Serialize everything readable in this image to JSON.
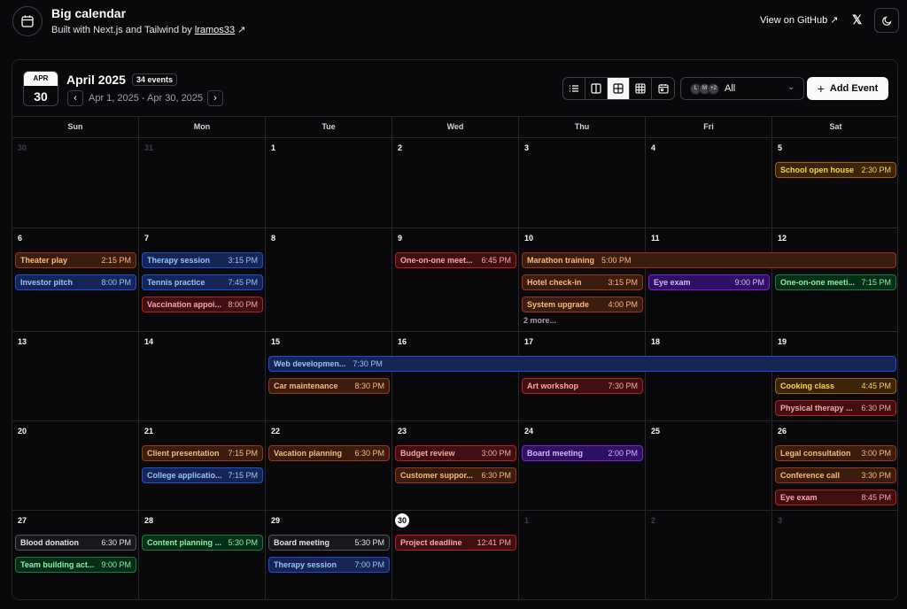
{
  "app": {
    "title": "Big calendar",
    "subtitle_prefix": "Built with Next.js and Tailwind by",
    "author": "lramos33",
    "github_label": "View on GitHub"
  },
  "toolbar": {
    "badge_month": "APR",
    "badge_day": "30",
    "month_title": "April 2025",
    "event_count": "34 events",
    "range": "Apr 1, 2025 - Apr 30, 2025",
    "user_filter": "All",
    "avatars": [
      "L",
      "M",
      "+2"
    ],
    "add_event": "Add Event"
  },
  "weekdays": [
    "Sun",
    "Mon",
    "Tue",
    "Wed",
    "Thu",
    "Fri",
    "Sat"
  ],
  "weeks": [
    [
      {
        "n": "30",
        "out": true
      },
      {
        "n": "31",
        "out": true
      },
      {
        "n": "1"
      },
      {
        "n": "2"
      },
      {
        "n": "3"
      },
      {
        "n": "4"
      },
      {
        "n": "5"
      }
    ],
    [
      {
        "n": "6"
      },
      {
        "n": "7"
      },
      {
        "n": "8"
      },
      {
        "n": "9"
      },
      {
        "n": "10"
      },
      {
        "n": "11"
      },
      {
        "n": "12"
      }
    ],
    [
      {
        "n": "13"
      },
      {
        "n": "14"
      },
      {
        "n": "15"
      },
      {
        "n": "16"
      },
      {
        "n": "17"
      },
      {
        "n": "18"
      },
      {
        "n": "19"
      }
    ],
    [
      {
        "n": "20"
      },
      {
        "n": "21"
      },
      {
        "n": "22"
      },
      {
        "n": "23"
      },
      {
        "n": "24"
      },
      {
        "n": "25"
      },
      {
        "n": "26"
      }
    ],
    [
      {
        "n": "27"
      },
      {
        "n": "28"
      },
      {
        "n": "29"
      },
      {
        "n": "30",
        "today": true
      },
      {
        "n": "1",
        "out": true
      },
      {
        "n": "2",
        "out": true
      },
      {
        "n": "3",
        "out": true
      }
    ]
  ],
  "events": [
    {
      "title": "School open house",
      "time": "2:30 PM",
      "week": 0,
      "day": 6,
      "slot": 0,
      "span": 1,
      "color": "yellow"
    },
    {
      "title": "Theater play",
      "time": "2:15 PM",
      "week": 1,
      "day": 0,
      "slot": 0,
      "span": 1,
      "color": "orange"
    },
    {
      "title": "Investor pitch",
      "time": "8:00 PM",
      "week": 1,
      "day": 0,
      "slot": 1,
      "span": 1,
      "color": "blue"
    },
    {
      "title": "Therapy session",
      "time": "3:15 PM",
      "week": 1,
      "day": 1,
      "slot": 0,
      "span": 1,
      "color": "blue"
    },
    {
      "title": "Tennis practice",
      "time": "7:45 PM",
      "week": 1,
      "day": 1,
      "slot": 1,
      "span": 1,
      "color": "blue"
    },
    {
      "title": "Vaccination appoi...",
      "time": "8:00 PM",
      "week": 1,
      "day": 1,
      "slot": 2,
      "span": 1,
      "color": "red"
    },
    {
      "title": "One-on-one meet...",
      "time": "6:45 PM",
      "week": 1,
      "day": 3,
      "slot": 0,
      "span": 1,
      "color": "red"
    },
    {
      "title": "Marathon training",
      "time": "5:00 PM",
      "week": 1,
      "day": 4,
      "slot": 0,
      "span": 3,
      "color": "orange"
    },
    {
      "title": "Hotel check-in",
      "time": "3:15 PM",
      "week": 1,
      "day": 4,
      "slot": 1,
      "span": 1,
      "color": "orange"
    },
    {
      "title": "System upgrade",
      "time": "4:00 PM",
      "week": 1,
      "day": 4,
      "slot": 2,
      "span": 1,
      "color": "orange"
    },
    {
      "title": "Eye exam",
      "time": "9:00 PM",
      "week": 1,
      "day": 5,
      "slot": 1,
      "span": 1,
      "color": "purple"
    },
    {
      "title": "One-on-one meeti...",
      "time": "7:15 PM",
      "week": 1,
      "day": 6,
      "slot": 1,
      "span": 1,
      "color": "green"
    },
    {
      "title": "Web developmen...",
      "time": "7:30 PM",
      "week": 2,
      "day": 2,
      "slot": 0,
      "span": 5,
      "color": "blue"
    },
    {
      "title": "Car maintenance",
      "time": "8:30 PM",
      "week": 2,
      "day": 2,
      "slot": 1,
      "span": 1,
      "color": "orange"
    },
    {
      "title": "Art workshop",
      "time": "7:30 PM",
      "week": 2,
      "day": 4,
      "slot": 1,
      "span": 1,
      "color": "red"
    },
    {
      "title": "Cooking class",
      "time": "4:45 PM",
      "week": 2,
      "day": 6,
      "slot": 1,
      "span": 1,
      "color": "yellow"
    },
    {
      "title": "Physical therapy ...",
      "time": "6:30 PM",
      "week": 2,
      "day": 6,
      "slot": 2,
      "span": 1,
      "color": "red"
    },
    {
      "title": "Client presentation",
      "time": "7:15 PM",
      "week": 3,
      "day": 1,
      "slot": 0,
      "span": 1,
      "color": "orange"
    },
    {
      "title": "College applicatio...",
      "time": "7:15 PM",
      "week": 3,
      "day": 1,
      "slot": 1,
      "span": 1,
      "color": "blue"
    },
    {
      "title": "Vacation planning",
      "time": "6:30 PM",
      "week": 3,
      "day": 2,
      "slot": 0,
      "span": 1,
      "color": "orange"
    },
    {
      "title": "Budget review",
      "time": "3:00 PM",
      "week": 3,
      "day": 3,
      "slot": 0,
      "span": 1,
      "color": "red"
    },
    {
      "title": "Customer suppor...",
      "time": "6:30 PM",
      "week": 3,
      "day": 3,
      "slot": 1,
      "span": 1,
      "color": "orange"
    },
    {
      "title": "Board meeting",
      "time": "2:00 PM",
      "week": 3,
      "day": 4,
      "slot": 0,
      "span": 1,
      "color": "purple"
    },
    {
      "title": "Legal consultation",
      "time": "3:00 PM",
      "week": 3,
      "day": 6,
      "slot": 0,
      "span": 1,
      "color": "orange"
    },
    {
      "title": "Conference call",
      "time": "3:30 PM",
      "week": 3,
      "day": 6,
      "slot": 1,
      "span": 1,
      "color": "orange"
    },
    {
      "title": "Eye exam",
      "time": "8:45 PM",
      "week": 3,
      "day": 6,
      "slot": 2,
      "span": 1,
      "color": "red"
    },
    {
      "title": "Blood donation",
      "time": "6:30 PM",
      "week": 4,
      "day": 0,
      "slot": 0,
      "span": 1,
      "color": "gray"
    },
    {
      "title": "Team building act...",
      "time": "9:00 PM",
      "week": 4,
      "day": 0,
      "slot": 1,
      "span": 1,
      "color": "green"
    },
    {
      "title": "Content planning ...",
      "time": "5:30 PM",
      "week": 4,
      "day": 1,
      "slot": 0,
      "span": 1,
      "color": "green"
    },
    {
      "title": "Board meeting",
      "time": "5:30 PM",
      "week": 4,
      "day": 2,
      "slot": 0,
      "span": 1,
      "color": "gray"
    },
    {
      "title": "Therapy session",
      "time": "7:00 PM",
      "week": 4,
      "day": 2,
      "slot": 1,
      "span": 1,
      "color": "blue"
    },
    {
      "title": "Project deadline",
      "time": "12:41 PM",
      "week": 4,
      "day": 3,
      "slot": 0,
      "span": 1,
      "color": "red"
    }
  ],
  "more_links": [
    {
      "label": "2 more...",
      "week": 1,
      "day": 4
    }
  ]
}
